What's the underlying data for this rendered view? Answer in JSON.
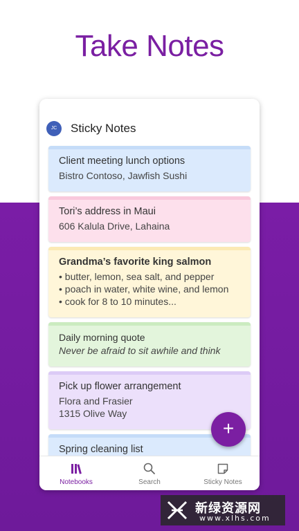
{
  "hero": {
    "title": "Take Notes"
  },
  "app": {
    "avatar_initials": "JC",
    "title": "Sticky Notes"
  },
  "notes": [
    {
      "title": "Client meeting lunch options",
      "lines": [
        "Bistro Contoso, Jawfish Sushi"
      ],
      "bg": "#dbeafd",
      "bar": "#c5dcf8"
    },
    {
      "title": "Tori’s address in Maui",
      "lines": [
        "606 Kalula Drive, Lahaina"
      ],
      "bg": "#fde0ec",
      "bar": "#f9c9dc"
    },
    {
      "title": "Grandma’s favorite king salmon",
      "lines": [
        "• butter, lemon, sea salt, and pepper",
        "• poach in water, white wine, and lemon",
        "• cook for 8 to 10 minutes..."
      ],
      "bg": "#fff6d9",
      "bar": "#fbeab5"
    },
    {
      "title": "Daily morning quote",
      "lines": [
        "Never be afraid to sit awhile and think"
      ],
      "bg": "#e3f5dc",
      "bar": "#cbebc0"
    },
    {
      "title": "Pick up flower arrangement",
      "lines": [
        "Flora and Frasier",
        "1315 Olive Way"
      ],
      "bg": "#ece0fb",
      "bar": "#dccbf6"
    },
    {
      "title": "Spring cleaning list",
      "lines": [],
      "bg": "#dbeafd",
      "bar": "#c5dcf8"
    }
  ],
  "fab": {
    "label": "+"
  },
  "nav": {
    "notebooks": "Notebooks",
    "search": "Search",
    "sticky_notes": "Sticky Notes"
  },
  "colors": {
    "accent": "#7b1fa2"
  },
  "watermark": {
    "text": "新绿资源网",
    "url": "www.xlhs.com"
  }
}
